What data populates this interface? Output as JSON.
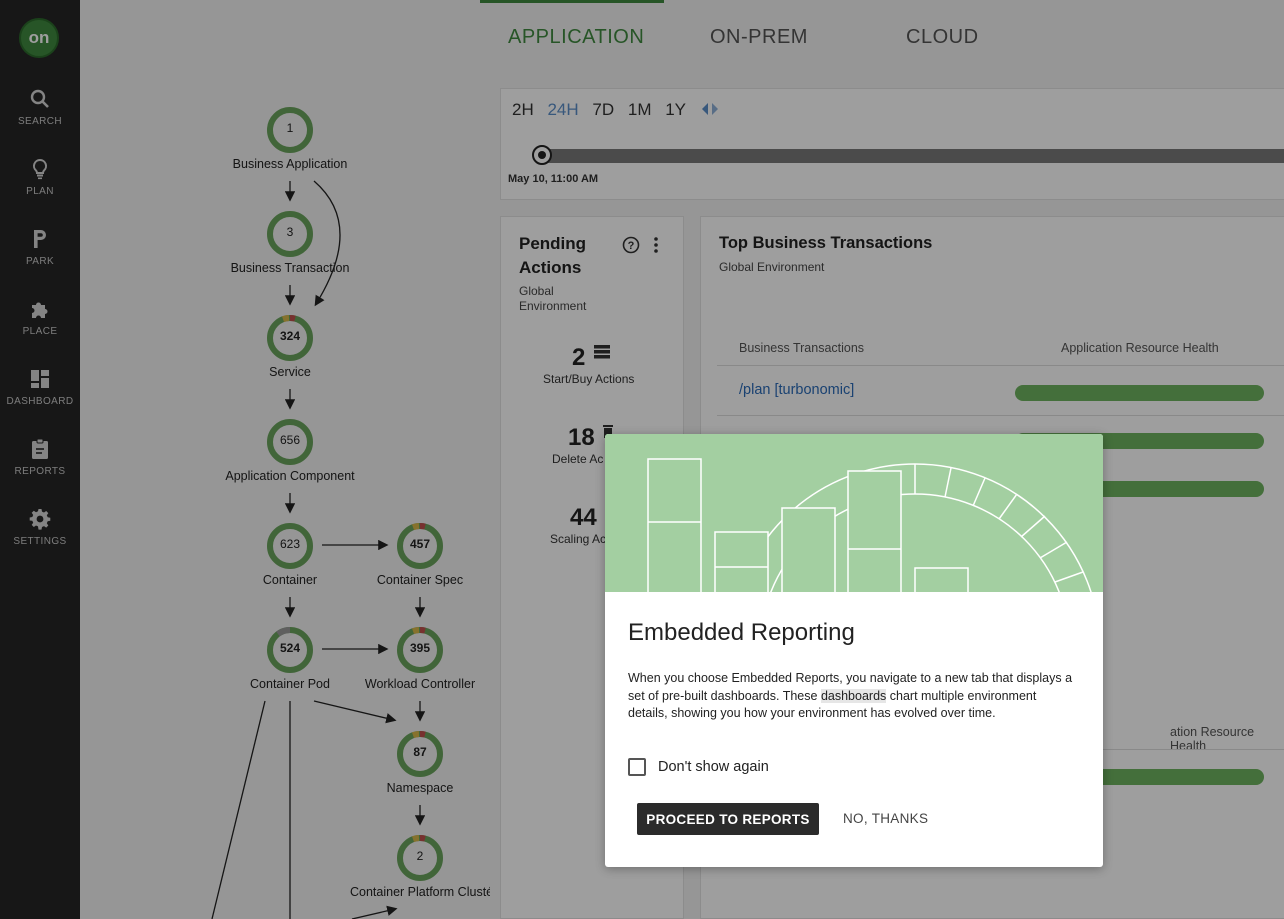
{
  "sidebar": {
    "logo": "on",
    "items": [
      {
        "label": "SEARCH",
        "icon": "search-icon"
      },
      {
        "label": "PLAN",
        "icon": "lightbulb-icon"
      },
      {
        "label": "PARK",
        "icon": "park-icon"
      },
      {
        "label": "PLACE",
        "icon": "puzzle-icon"
      },
      {
        "label": "DASHBOARD",
        "icon": "dashboard-icon"
      },
      {
        "label": "REPORTS",
        "icon": "clipboard-icon"
      },
      {
        "label": "SETTINGS",
        "icon": "gear-icon"
      }
    ]
  },
  "tabs": [
    {
      "label": "APPLICATION",
      "active": true
    },
    {
      "label": "ON-PREM",
      "active": false
    },
    {
      "label": "CLOUD",
      "active": false
    }
  ],
  "timeline": {
    "ranges": [
      "2H",
      "24H",
      "7D",
      "1M",
      "1Y"
    ],
    "selected": "24H",
    "date": "May 10, 11:00 AM"
  },
  "supply_chain": {
    "nodes": [
      {
        "id": "business-application",
        "label": "Business Application",
        "count": "1"
      },
      {
        "id": "business-transaction",
        "label": "Business Transaction",
        "count": "3"
      },
      {
        "id": "service",
        "label": "Service",
        "count": "324"
      },
      {
        "id": "application-component",
        "label": "Application Component",
        "count": "656"
      },
      {
        "id": "container",
        "label": "Container",
        "count": "623"
      },
      {
        "id": "container-spec",
        "label": "Container Spec",
        "count": "457"
      },
      {
        "id": "container-pod",
        "label": "Container Pod",
        "count": "524"
      },
      {
        "id": "workload-controller",
        "label": "Workload Controller",
        "count": "395"
      },
      {
        "id": "namespace",
        "label": "Namespace",
        "count": "87"
      },
      {
        "id": "container-platform-cluster",
        "label": "Container Platform Clusté",
        "count": "2"
      }
    ]
  },
  "pending_actions": {
    "title_line1": "Pending",
    "title_line2": "Actions",
    "sub_line1": "Global",
    "sub_line2": "Environment",
    "items": [
      {
        "count": "2",
        "label": "Start/Buy Actions"
      },
      {
        "count": "18",
        "label": "Delete Ac"
      },
      {
        "count": "44",
        "label": "Scaling Ac"
      }
    ]
  },
  "top_bt": {
    "title": "Top Business Transactions",
    "subtitle": "Global Environment",
    "col1": "Business Transactions",
    "col2": "Application Resource Health",
    "rows": [
      {
        "name": "/plan [turbonomic]",
        "health": 1.0
      },
      {
        "name": "",
        "health": 1.0
      },
      {
        "name": "",
        "health": 1.0
      }
    ],
    "col2_lower": "ation Resource Health"
  },
  "modal": {
    "title": "Embedded Reporting",
    "body_pre": "When you choose Embedded Reports, you navigate to a new tab that displays a set of pre-built dashboards. These ",
    "body_highlight": "dashboards",
    "body_post": " chart multiple environment details, showing you how your environment has evolved over time.",
    "checkbox_label": "Don't show again",
    "checkbox_checked": false,
    "primary_button": "PROCEED TO REPORTS",
    "secondary_button": "NO, THANKS"
  },
  "colors": {
    "accent": "#3f8a3f",
    "health_bar": "#6fb35f",
    "hero": "#a3cfa1",
    "link": "#2b6bb8"
  }
}
